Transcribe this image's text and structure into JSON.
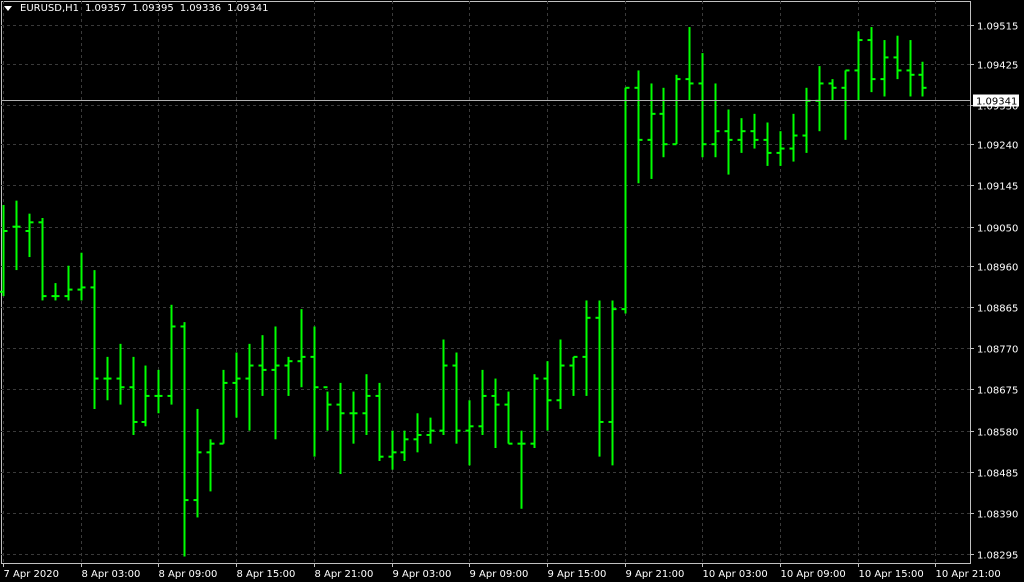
{
  "header": {
    "symbol_tf": "EURUSD,H1",
    "ohlc": [
      "1.09357",
      "1.09395",
      "1.09336",
      "1.09341"
    ]
  },
  "colors": {
    "background": "#000000",
    "bars": "#00ff00",
    "grid": "#3a3a3a",
    "axis": "#c0c0c0",
    "text": "#ffffff",
    "price_label_bg": "#ffffff",
    "price_label_text": "#000000"
  },
  "chart_data": {
    "type": "ohlc",
    "symbol": "EURUSD",
    "timeframe": "H1",
    "current_price": 1.09341,
    "current_price_label": "1.09341",
    "grid": true,
    "ylim": [
      1.08275,
      1.0957
    ],
    "y_ticks": [
      "1.09515",
      "1.09425",
      "1.09330",
      "1.09240",
      "1.09145",
      "1.09050",
      "1.08960",
      "1.08865",
      "1.08770",
      "1.08675",
      "1.08580",
      "1.08485",
      "1.08390",
      "1.08295"
    ],
    "x_tick_labels": [
      "7 Apr 2020",
      "8 Apr 03:00",
      "8 Apr 09:00",
      "8 Apr 15:00",
      "8 Apr 21:00",
      "9 Apr 03:00",
      "9 Apr 09:00",
      "9 Apr 15:00",
      "9 Apr 21:00",
      "10 Apr 03:00",
      "10 Apr 09:00",
      "10 Apr 15:00",
      "10 Apr 21:00"
    ],
    "x_tick_bar_index": [
      0,
      6,
      12,
      18,
      24,
      30,
      36,
      42,
      48,
      54,
      60,
      66,
      72
    ],
    "bars": [
      [
        1.089,
        1.091,
        1.0889,
        1.0904
      ],
      [
        1.0905,
        1.0911,
        1.0895,
        1.0905
      ],
      [
        1.0904,
        1.0908,
        1.0898,
        1.0906
      ],
      [
        1.0906,
        1.0907,
        1.0888,
        1.0889
      ],
      [
        1.0889,
        1.0892,
        1.0888,
        1.0889
      ],
      [
        1.0889,
        1.0896,
        1.0888,
        1.08905
      ],
      [
        1.08905,
        1.0899,
        1.0888,
        1.0891
      ],
      [
        1.0891,
        1.0895,
        1.0863,
        1.087
      ],
      [
        1.087,
        1.0875,
        1.0865,
        1.087
      ],
      [
        1.087,
        1.0878,
        1.0864,
        1.0868
      ],
      [
        1.0868,
        1.0875,
        1.0857,
        1.086
      ],
      [
        1.086,
        1.0873,
        1.0859,
        1.0866
      ],
      [
        1.0866,
        1.0872,
        1.0862,
        1.0866
      ],
      [
        1.0866,
        1.0887,
        1.0864,
        1.0882
      ],
      [
        1.0882,
        1.0883,
        1.0829,
        1.0842
      ],
      [
        1.0842,
        1.0863,
        1.0838,
        1.0853
      ],
      [
        1.0853,
        1.0856,
        1.0844,
        1.0855
      ],
      [
        1.0855,
        1.0872,
        1.0855,
        1.0869
      ],
      [
        1.0869,
        1.0876,
        1.0861,
        1.087
      ],
      [
        1.087,
        1.0878,
        1.0858,
        1.0873
      ],
      [
        1.0873,
        1.088,
        1.0866,
        1.0872
      ],
      [
        1.0872,
        1.0882,
        1.0856,
        1.0873
      ],
      [
        1.0873,
        1.0875,
        1.0866,
        1.0874
      ],
      [
        1.0874,
        1.0886,
        1.0868,
        1.0875
      ],
      [
        1.0875,
        1.0882,
        1.0852,
        1.0868
      ],
      [
        1.0868,
        1.0867,
        1.0858,
        1.0864
      ],
      [
        1.0864,
        1.0869,
        1.0848,
        1.0862
      ],
      [
        1.0862,
        1.0867,
        1.0855,
        1.0862
      ],
      [
        1.0862,
        1.0871,
        1.0857,
        1.0866
      ],
      [
        1.0866,
        1.0869,
        1.0851,
        1.0852
      ],
      [
        1.0852,
        1.0858,
        1.0849,
        1.0853
      ],
      [
        1.0853,
        1.0858,
        1.0851,
        1.0856
      ],
      [
        1.0856,
        1.0862,
        1.0853,
        1.0857
      ],
      [
        1.0857,
        1.0861,
        1.0855,
        1.0858
      ],
      [
        1.0858,
        1.0879,
        1.0857,
        1.0873
      ],
      [
        1.0873,
        1.0876,
        1.0855,
        1.0858
      ],
      [
        1.0858,
        1.0865,
        1.085,
        1.0859
      ],
      [
        1.0859,
        1.0872,
        1.0857,
        1.0866
      ],
      [
        1.0866,
        1.087,
        1.0854,
        1.0864
      ],
      [
        1.0864,
        1.0867,
        1.0855,
        1.0855
      ],
      [
        1.0855,
        1.0858,
        1.084,
        1.0855
      ],
      [
        1.0855,
        1.0871,
        1.0854,
        1.087
      ],
      [
        1.087,
        1.0874,
        1.0858,
        1.0865
      ],
      [
        1.0865,
        1.0879,
        1.0863,
        1.0873
      ],
      [
        1.0873,
        1.0875,
        1.0866,
        1.0875
      ],
      [
        1.0875,
        1.0888,
        1.0866,
        1.0884
      ],
      [
        1.0884,
        1.0888,
        1.0852,
        1.086
      ],
      [
        1.086,
        1.0888,
        1.085,
        1.0886
      ],
      [
        1.0886,
        1.0937,
        1.0885,
        1.0937
      ],
      [
        1.0937,
        1.0941,
        1.0915,
        1.0925
      ],
      [
        1.0925,
        1.0938,
        1.0916,
        1.0931
      ],
      [
        1.0931,
        1.0937,
        1.0921,
        1.0924
      ],
      [
        1.0924,
        1.094,
        1.0924,
        1.0939
      ],
      [
        1.0939,
        1.0951,
        1.0934,
        1.0938
      ],
      [
        1.0938,
        1.0945,
        1.0921,
        1.0924
      ],
      [
        1.0924,
        1.0938,
        1.0921,
        1.0927
      ],
      [
        1.0927,
        1.0932,
        1.0917,
        1.0925
      ],
      [
        1.0925,
        1.093,
        1.0922,
        1.0927
      ],
      [
        1.0927,
        1.0931,
        1.0923,
        1.0925
      ],
      [
        1.0925,
        1.0929,
        1.0919,
        1.0922
      ],
      [
        1.0922,
        1.0927,
        1.0919,
        1.0923
      ],
      [
        1.0923,
        1.0931,
        1.092,
        1.0926
      ],
      [
        1.0926,
        1.0937,
        1.0922,
        1.0934
      ],
      [
        1.0934,
        1.0942,
        1.0927,
        1.0938
      ],
      [
        1.0938,
        1.0939,
        1.0934,
        1.0937
      ],
      [
        1.0937,
        1.0941,
        1.0925,
        1.0941
      ],
      [
        1.0941,
        1.095,
        1.0934,
        1.0948
      ],
      [
        1.0948,
        1.0951,
        1.0936,
        1.0939
      ],
      [
        1.0939,
        1.0948,
        1.0935,
        1.0944
      ],
      [
        1.0944,
        1.0949,
        1.0939,
        1.0941
      ],
      [
        1.0941,
        1.0948,
        1.0935,
        1.094
      ],
      [
        1.094,
        1.0943,
        1.0935,
        1.0937
      ]
    ]
  }
}
